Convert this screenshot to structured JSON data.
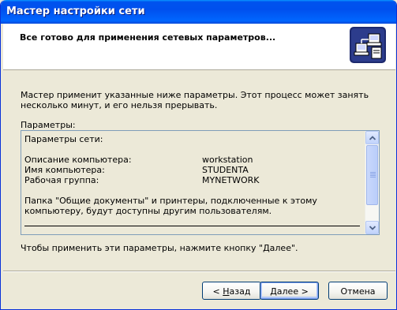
{
  "window": {
    "title": "Мастер настройки сети"
  },
  "header": {
    "heading": "Все готово для применения сетевых параметров...",
    "icon": "network-computers-icon"
  },
  "body": {
    "description": "Мастер применит указанные ниже параметры. Этот процесс может занять несколько минут, и его нельзя прерывать.",
    "params_label": "Параметры:",
    "params": {
      "section_title": "Параметры сети:",
      "rows": [
        {
          "label": "Описание компьютера:",
          "value": "workstation"
        },
        {
          "label": "Имя компьютера:",
          "value": "STUDENTA"
        },
        {
          "label": "Рабочая группа:",
          "value": "MYNETWORK"
        }
      ],
      "note": "Папка \"Общие документы\" и принтеры, подключенные к этому компьютеру, будут доступны другим пользователям."
    },
    "footer_text": "Чтобы применить эти параметры, нажмите кнопку \"Далее\"."
  },
  "buttons": {
    "back": {
      "mnemonic": "Н",
      "rest": "азад",
      "prefix": "< "
    },
    "next": {
      "mnemonic": "Д",
      "rest": "алее",
      "suffix": " >"
    },
    "cancel": {
      "label": "Отмена"
    }
  },
  "colors": {
    "title_bar": "#0054e3",
    "face": "#ece9d8",
    "border": "#0831d9"
  }
}
